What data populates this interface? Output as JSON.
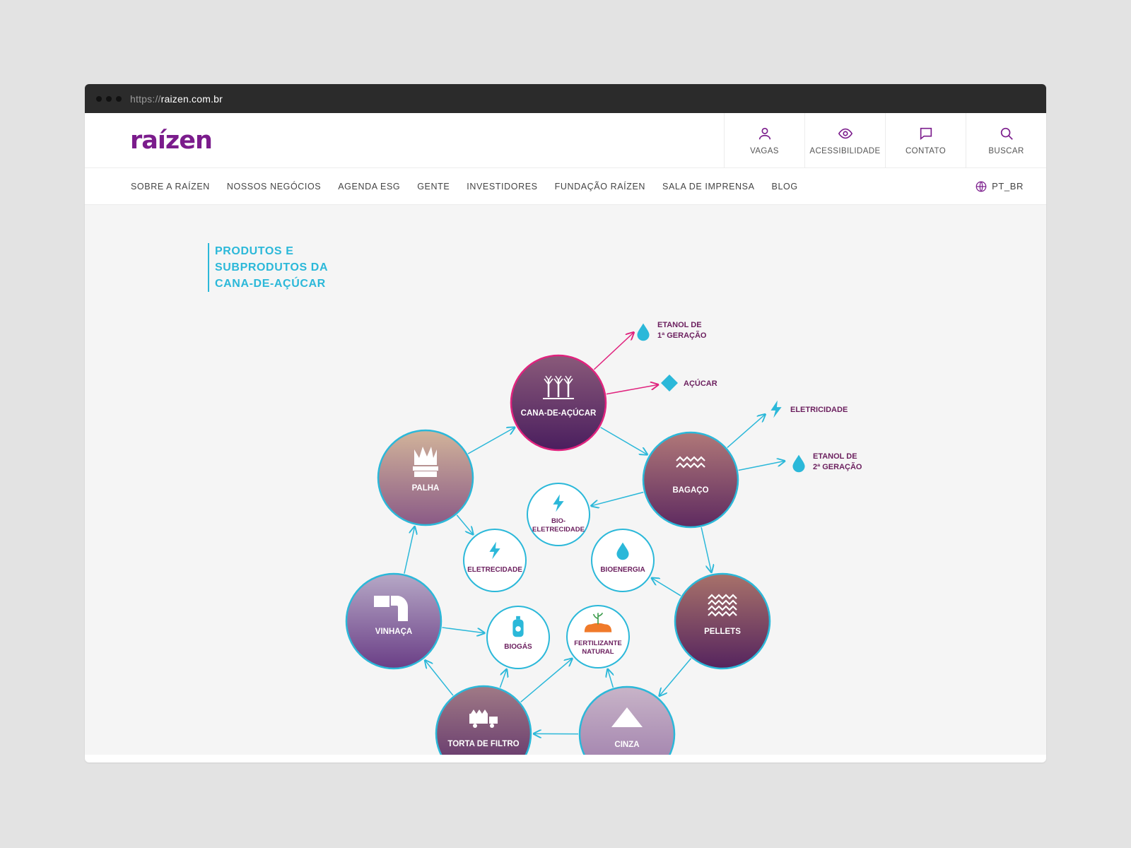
{
  "browser": {
    "url_protocol": "https://",
    "url_host": "raizen.com.br"
  },
  "logo": {
    "text": "raízen",
    "color": "#7b1c8c"
  },
  "utilities": [
    {
      "label": "VAGAS",
      "icon": "user-icon"
    },
    {
      "label": "ACESSIBILIDADE",
      "icon": "eye-icon"
    },
    {
      "label": "CONTATO",
      "icon": "chat-icon"
    },
    {
      "label": "BUSCAR",
      "icon": "search-icon"
    }
  ],
  "nav": {
    "items": [
      "SOBRE A RAÍZEN",
      "NOSSOS NEGÓCIOS",
      "AGENDA ESG",
      "GENTE",
      "INVESTIDORES",
      "FUNDAÇÃO RAÍZEN",
      "SALA DE IMPRENSA",
      "BLOG"
    ],
    "language": "PT_BR"
  },
  "diagram": {
    "title_lines": [
      "PRODUTOS E",
      "SUBPRODUTOS DA",
      "CANA-DE-AÇÚCAR"
    ],
    "colors": {
      "accent": "#2bb8d9",
      "brand": "#7b1c8c",
      "pink": "#e0237e",
      "label": "#6b1f5e",
      "fertilizer": "#f07a2a"
    },
    "large_nodes": [
      {
        "id": "cana",
        "label": "CANA-DE-AÇÚCAR",
        "icon": "sugarcane-plant-icon"
      },
      {
        "id": "bagaco",
        "label": "BAGAÇO",
        "icon": "waves-icon"
      },
      {
        "id": "pellets",
        "label": "PELLETS",
        "icon": "layered-waves-icon"
      },
      {
        "id": "cinza",
        "label": "CINZA",
        "icon": "triangle-pile-icon"
      },
      {
        "id": "torta",
        "label": "TORTA DE FILTRO",
        "icon": "truck-icon"
      },
      {
        "id": "vinhaca",
        "label": "VINHAÇA",
        "icon": "pipe-icon"
      },
      {
        "id": "palha",
        "label": "PALHA",
        "icon": "crown-bale-icon"
      }
    ],
    "small_nodes": [
      {
        "id": "bioelet",
        "lines": [
          "BIO-",
          "ELETRECIDADE"
        ],
        "icon": "lightning-icon"
      },
      {
        "id": "eletr",
        "lines": [
          "ELETRECIDADE"
        ],
        "icon": "lightning-icon"
      },
      {
        "id": "bioen",
        "lines": [
          "BIOENERGIA"
        ],
        "icon": "drop-icon"
      },
      {
        "id": "biogas",
        "lines": [
          "BIOGÁS"
        ],
        "icon": "gas-cylinder-icon"
      },
      {
        "id": "fert",
        "lines": [
          "FERTILIZANTE",
          "NATURAL"
        ],
        "icon": "sprout-soil-icon"
      }
    ],
    "outputs": [
      {
        "id": "etanol1",
        "lines": [
          "ETANOL DE",
          "1ª GERAÇÃO"
        ],
        "icon": "drop-icon"
      },
      {
        "id": "acucar",
        "lines": [
          "AÇÚCAR"
        ],
        "icon": "diamond-icon"
      },
      {
        "id": "eletricidade",
        "lines": [
          "ELETRICIDADE"
        ],
        "icon": "lightning-icon"
      },
      {
        "id": "etanol2",
        "lines": [
          "ETANOL DE",
          "2ª GERAÇÃO"
        ],
        "icon": "drop-icon"
      }
    ]
  }
}
